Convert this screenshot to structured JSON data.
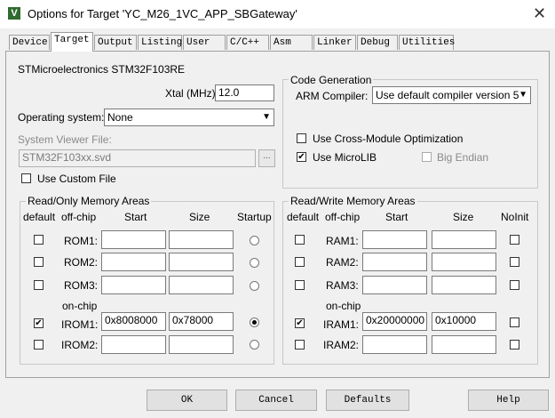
{
  "window": {
    "title": "Options for Target 'YC_M26_1VC_APP_SBGateway'",
    "icon": "keil-uvision-icon",
    "close": "✕"
  },
  "tabs": [
    "Device",
    "Target",
    "Output",
    "Listing",
    "User",
    "C/C++",
    "Asm",
    "Linker",
    "Debug",
    "Utilities"
  ],
  "active_tab": "Target",
  "target": {
    "device": "STMicroelectronics STM32F103RE",
    "xtal_label": "Xtal (MHz):",
    "xtal_value": "12.0",
    "os_label": "Operating system:",
    "os_value": "None",
    "svf_label": "System Viewer File:",
    "svf_value": "STM32F103xx.svd",
    "svf_browse": "...",
    "use_custom_file": "Use Custom File"
  },
  "codegen": {
    "title": "Code Generation",
    "compiler_label": "ARM Compiler:",
    "compiler_value": "Use default compiler version 5",
    "cross_module": "Use Cross-Module Optimization",
    "microlib": "Use MicroLIB",
    "big_endian": "Big Endian"
  },
  "ro": {
    "title": "Read/Only Memory Areas",
    "headers": {
      "default": "default",
      "offchip": "off-chip",
      "start": "Start",
      "size": "Size",
      "last": "Startup"
    },
    "onchip": "on-chip",
    "rows": [
      {
        "label": "ROM1:",
        "start": "",
        "size": "",
        "default": false,
        "selected": false
      },
      {
        "label": "ROM2:",
        "start": "",
        "size": "",
        "default": false,
        "selected": false
      },
      {
        "label": "ROM3:",
        "start": "",
        "size": "",
        "default": false,
        "selected": false
      },
      {
        "label": "IROM1:",
        "start": "0x8008000",
        "size": "0x78000",
        "default": true,
        "selected": true
      },
      {
        "label": "IROM2:",
        "start": "",
        "size": "",
        "default": false,
        "selected": false
      }
    ]
  },
  "rw": {
    "title": "Read/Write Memory Areas",
    "headers": {
      "default": "default",
      "offchip": "off-chip",
      "start": "Start",
      "size": "Size",
      "last": "NoInit"
    },
    "onchip": "on-chip",
    "rows": [
      {
        "label": "RAM1:",
        "start": "",
        "size": "",
        "default": false,
        "noinit": false
      },
      {
        "label": "RAM2:",
        "start": "",
        "size": "",
        "default": false,
        "noinit": false
      },
      {
        "label": "RAM3:",
        "start": "",
        "size": "",
        "default": false,
        "noinit": false
      },
      {
        "label": "IRAM1:",
        "start": "0x20000000",
        "size": "0x10000",
        "default": true,
        "noinit": false
      },
      {
        "label": "IRAM2:",
        "start": "",
        "size": "",
        "default": false,
        "noinit": false
      }
    ]
  },
  "buttons": {
    "ok": "OK",
    "cancel": "Cancel",
    "defaults": "Defaults",
    "help": "Help"
  },
  "checkmark": "✔",
  "dropdown_arrow": "▼"
}
